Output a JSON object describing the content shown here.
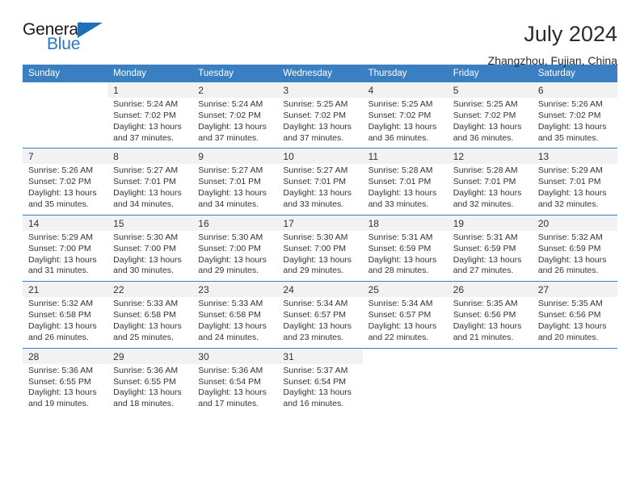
{
  "logo": {
    "word_one": "General",
    "word_two": "Blue",
    "triangle_icon": "triangle-icon",
    "accent_color": "#2579c4"
  },
  "header": {
    "title": "July 2024",
    "subtitle": "Zhangzhou, Fujian, China"
  },
  "calendar": {
    "header_bg": "#3a7fc1",
    "daynum_bg": "#f2f2f2",
    "weekdays": [
      "Sunday",
      "Monday",
      "Tuesday",
      "Wednesday",
      "Thursday",
      "Friday",
      "Saturday"
    ],
    "weeks": [
      [
        {
          "day": "",
          "lines": []
        },
        {
          "day": "1",
          "lines": [
            "Sunrise: 5:24 AM",
            "Sunset: 7:02 PM",
            "Daylight: 13 hours",
            "and 37 minutes."
          ]
        },
        {
          "day": "2",
          "lines": [
            "Sunrise: 5:24 AM",
            "Sunset: 7:02 PM",
            "Daylight: 13 hours",
            "and 37 minutes."
          ]
        },
        {
          "day": "3",
          "lines": [
            "Sunrise: 5:25 AM",
            "Sunset: 7:02 PM",
            "Daylight: 13 hours",
            "and 37 minutes."
          ]
        },
        {
          "day": "4",
          "lines": [
            "Sunrise: 5:25 AM",
            "Sunset: 7:02 PM",
            "Daylight: 13 hours",
            "and 36 minutes."
          ]
        },
        {
          "day": "5",
          "lines": [
            "Sunrise: 5:25 AM",
            "Sunset: 7:02 PM",
            "Daylight: 13 hours",
            "and 36 minutes."
          ]
        },
        {
          "day": "6",
          "lines": [
            "Sunrise: 5:26 AM",
            "Sunset: 7:02 PM",
            "Daylight: 13 hours",
            "and 35 minutes."
          ]
        }
      ],
      [
        {
          "day": "7",
          "lines": [
            "Sunrise: 5:26 AM",
            "Sunset: 7:02 PM",
            "Daylight: 13 hours",
            "and 35 minutes."
          ]
        },
        {
          "day": "8",
          "lines": [
            "Sunrise: 5:27 AM",
            "Sunset: 7:01 PM",
            "Daylight: 13 hours",
            "and 34 minutes."
          ]
        },
        {
          "day": "9",
          "lines": [
            "Sunrise: 5:27 AM",
            "Sunset: 7:01 PM",
            "Daylight: 13 hours",
            "and 34 minutes."
          ]
        },
        {
          "day": "10",
          "lines": [
            "Sunrise: 5:27 AM",
            "Sunset: 7:01 PM",
            "Daylight: 13 hours",
            "and 33 minutes."
          ]
        },
        {
          "day": "11",
          "lines": [
            "Sunrise: 5:28 AM",
            "Sunset: 7:01 PM",
            "Daylight: 13 hours",
            "and 33 minutes."
          ]
        },
        {
          "day": "12",
          "lines": [
            "Sunrise: 5:28 AM",
            "Sunset: 7:01 PM",
            "Daylight: 13 hours",
            "and 32 minutes."
          ]
        },
        {
          "day": "13",
          "lines": [
            "Sunrise: 5:29 AM",
            "Sunset: 7:01 PM",
            "Daylight: 13 hours",
            "and 32 minutes."
          ]
        }
      ],
      [
        {
          "day": "14",
          "lines": [
            "Sunrise: 5:29 AM",
            "Sunset: 7:00 PM",
            "Daylight: 13 hours",
            "and 31 minutes."
          ]
        },
        {
          "day": "15",
          "lines": [
            "Sunrise: 5:30 AM",
            "Sunset: 7:00 PM",
            "Daylight: 13 hours",
            "and 30 minutes."
          ]
        },
        {
          "day": "16",
          "lines": [
            "Sunrise: 5:30 AM",
            "Sunset: 7:00 PM",
            "Daylight: 13 hours",
            "and 29 minutes."
          ]
        },
        {
          "day": "17",
          "lines": [
            "Sunrise: 5:30 AM",
            "Sunset: 7:00 PM",
            "Daylight: 13 hours",
            "and 29 minutes."
          ]
        },
        {
          "day": "18",
          "lines": [
            "Sunrise: 5:31 AM",
            "Sunset: 6:59 PM",
            "Daylight: 13 hours",
            "and 28 minutes."
          ]
        },
        {
          "day": "19",
          "lines": [
            "Sunrise: 5:31 AM",
            "Sunset: 6:59 PM",
            "Daylight: 13 hours",
            "and 27 minutes."
          ]
        },
        {
          "day": "20",
          "lines": [
            "Sunrise: 5:32 AM",
            "Sunset: 6:59 PM",
            "Daylight: 13 hours",
            "and 26 minutes."
          ]
        }
      ],
      [
        {
          "day": "21",
          "lines": [
            "Sunrise: 5:32 AM",
            "Sunset: 6:58 PM",
            "Daylight: 13 hours",
            "and 26 minutes."
          ]
        },
        {
          "day": "22",
          "lines": [
            "Sunrise: 5:33 AM",
            "Sunset: 6:58 PM",
            "Daylight: 13 hours",
            "and 25 minutes."
          ]
        },
        {
          "day": "23",
          "lines": [
            "Sunrise: 5:33 AM",
            "Sunset: 6:58 PM",
            "Daylight: 13 hours",
            "and 24 minutes."
          ]
        },
        {
          "day": "24",
          "lines": [
            "Sunrise: 5:34 AM",
            "Sunset: 6:57 PM",
            "Daylight: 13 hours",
            "and 23 minutes."
          ]
        },
        {
          "day": "25",
          "lines": [
            "Sunrise: 5:34 AM",
            "Sunset: 6:57 PM",
            "Daylight: 13 hours",
            "and 22 minutes."
          ]
        },
        {
          "day": "26",
          "lines": [
            "Sunrise: 5:35 AM",
            "Sunset: 6:56 PM",
            "Daylight: 13 hours",
            "and 21 minutes."
          ]
        },
        {
          "day": "27",
          "lines": [
            "Sunrise: 5:35 AM",
            "Sunset: 6:56 PM",
            "Daylight: 13 hours",
            "and 20 minutes."
          ]
        }
      ],
      [
        {
          "day": "28",
          "lines": [
            "Sunrise: 5:36 AM",
            "Sunset: 6:55 PM",
            "Daylight: 13 hours",
            "and 19 minutes."
          ]
        },
        {
          "day": "29",
          "lines": [
            "Sunrise: 5:36 AM",
            "Sunset: 6:55 PM",
            "Daylight: 13 hours",
            "and 18 minutes."
          ]
        },
        {
          "day": "30",
          "lines": [
            "Sunrise: 5:36 AM",
            "Sunset: 6:54 PM",
            "Daylight: 13 hours",
            "and 17 minutes."
          ]
        },
        {
          "day": "31",
          "lines": [
            "Sunrise: 5:37 AM",
            "Sunset: 6:54 PM",
            "Daylight: 13 hours",
            "and 16 minutes."
          ]
        },
        {
          "day": "",
          "lines": []
        },
        {
          "day": "",
          "lines": []
        },
        {
          "day": "",
          "lines": []
        }
      ]
    ]
  }
}
